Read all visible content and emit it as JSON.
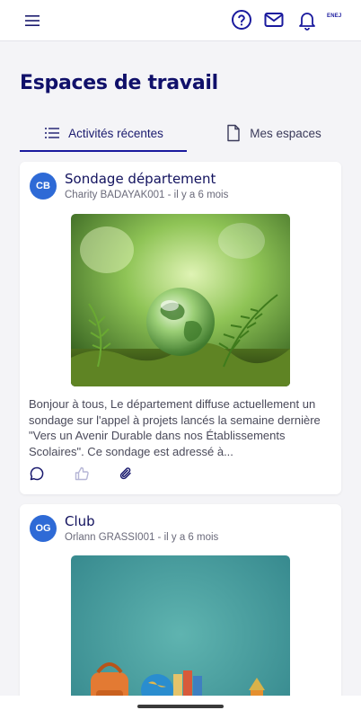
{
  "topbar": {
    "menu_icon": "hamburger-icon",
    "help_icon": "help-circle-icon",
    "mail_icon": "mail-icon",
    "bell_icon": "bell-icon",
    "brand_text": "ENEJ"
  },
  "page": {
    "title": "Espaces de travail"
  },
  "tabs": [
    {
      "label": "Activités récentes",
      "icon": "list-icon",
      "active": true
    },
    {
      "label": "Mes espaces",
      "icon": "document-icon",
      "active": false
    }
  ],
  "posts": [
    {
      "initials": "CB",
      "title": "Sondage département",
      "meta": "Charity BADAYAK001 - il y a 6 mois",
      "image": "glass-globe-on-moss-with-ferns",
      "text": "Bonjour à tous,   Le département diffuse actuellement un sondage sur l'appel à projets lancés la semaine dernière \"Vers un Avenir Durable dans nos Établissements Scolaires\". Ce sondage est adressé à...",
      "actions": [
        "comment-icon",
        "like-icon",
        "attachment-icon"
      ]
    },
    {
      "initials": "OG",
      "title": "Club",
      "meta": "Orlann GRASSI001 - il y a 6 mois",
      "image": "school-backpack-globe-books-on-teal-background"
    }
  ],
  "colors": {
    "primary": "#1a1a9e",
    "avatar": "#2e6ad6",
    "background": "#f4f4f7"
  }
}
